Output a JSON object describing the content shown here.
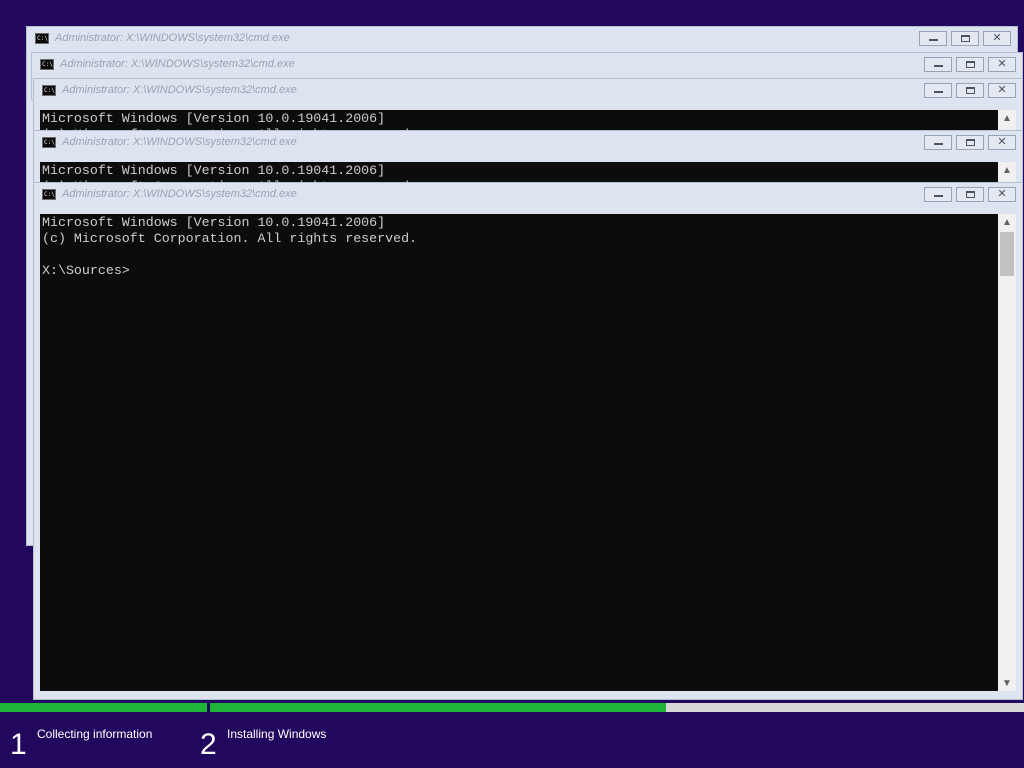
{
  "windows": [
    {
      "title": "Administrator: X:\\WINDOWS\\system32\\cmd.exe",
      "console_lines": []
    },
    {
      "title": "Administrator: X:\\WINDOWS\\system32\\cmd.exe",
      "console_lines": []
    },
    {
      "title": "Administrator: X:\\WINDOWS\\system32\\cmd.exe",
      "console_lines": [
        "Microsoft Windows [Version 10.0.19041.2006]",
        "(c) Microsoft Corporation. All rights reserved."
      ]
    },
    {
      "title": "Administrator: X:\\WINDOWS\\system32\\cmd.exe",
      "console_lines": [
        "Microsoft Windows [Version 10.0.19041.2006]",
        "(c) Microsoft Corporation. All rights reserved."
      ]
    },
    {
      "title": "Administrator: X:\\WINDOWS\\system32\\cmd.exe",
      "console_lines": [
        "Microsoft Windows [Version 10.0.19041.2006]",
        "(c) Microsoft Corporation. All rights reserved.",
        "",
        "X:\\Sources>"
      ]
    }
  ],
  "icons": {
    "cmd": "command-prompt-icon",
    "minimize": "minimize-icon",
    "maximize": "maximize-icon",
    "close": "close-icon",
    "scroll_up": "chevron-up-icon",
    "scroll_down": "chevron-down-icon"
  },
  "cmd_icon_glyph": "C:\\",
  "setup_steps": [
    {
      "number": "1",
      "label": "Collecting information",
      "progress": 1.0
    },
    {
      "number": "2",
      "label": "Installing Windows",
      "progress": 0.56
    }
  ],
  "colors": {
    "background": "#21075e",
    "progress_fill": "#20b33a",
    "console_bg": "#0c0c0c",
    "console_text": "#cccccc"
  }
}
